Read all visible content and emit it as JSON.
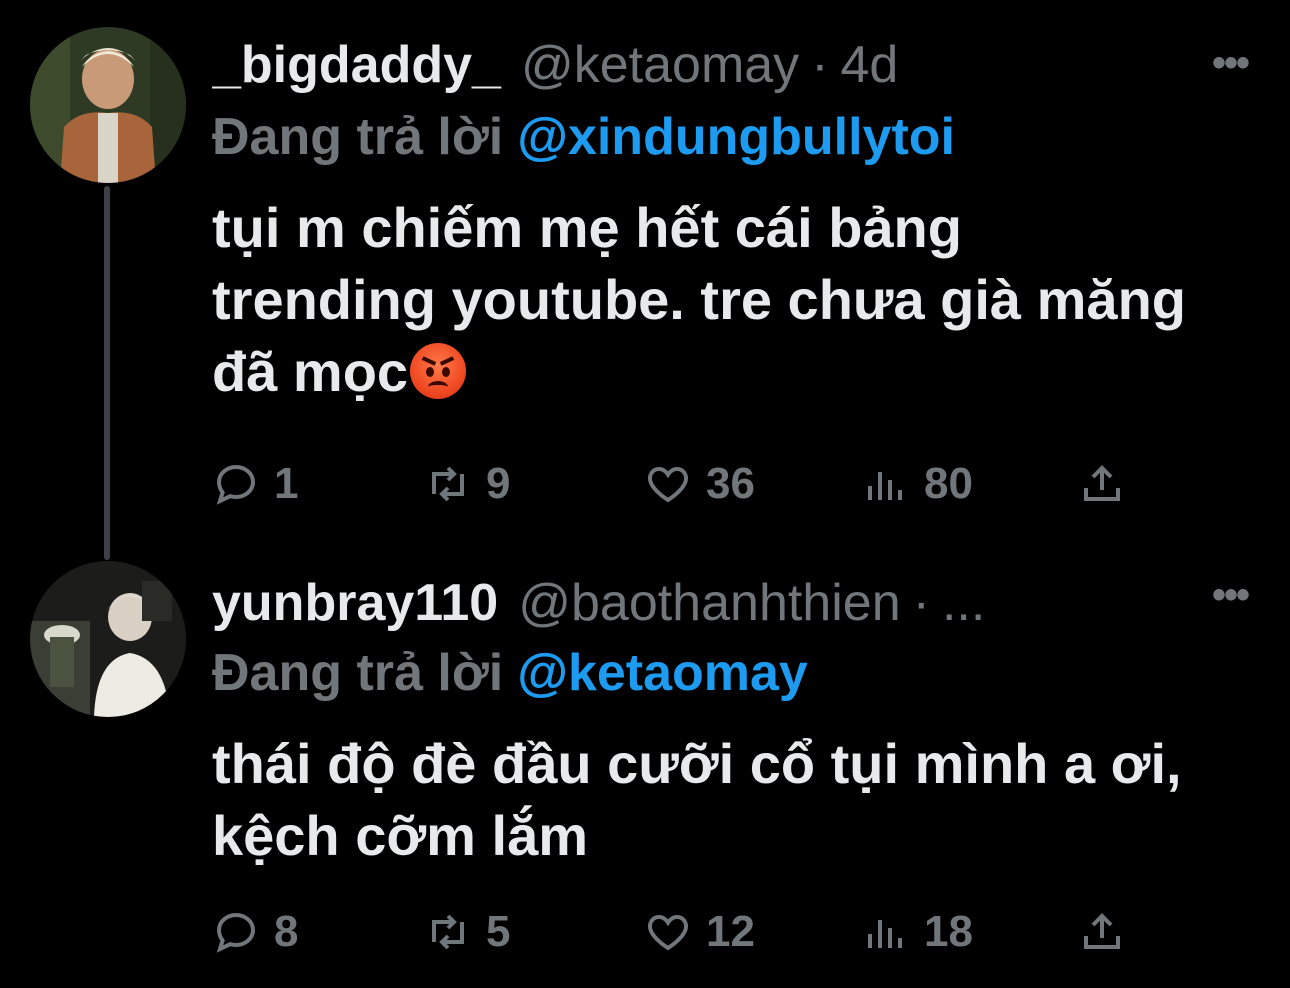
{
  "tweets": [
    {
      "display_name": "_bigdaddy_",
      "handle": "@ketaomay",
      "separator": "·",
      "time": "4d",
      "more": "•••",
      "replying_prefix": "Đang trả lời",
      "replying_to": "@xindungbullytoi",
      "text": "tụi m chiếm mẹ hết cái bảng trending youtube. tre chưa già măng đã mọc",
      "emoji": "angry-face-emoji",
      "stats": {
        "replies": "1",
        "retweets": "9",
        "likes": "36",
        "views": "80"
      }
    },
    {
      "display_name": "yunbray110",
      "handle": "@baothanhthien",
      "separator": "·",
      "time": "...",
      "more": "•••",
      "replying_prefix": "Đang trả lời",
      "replying_to": "@ketaomay",
      "text": "thái độ đè đầu cưỡi cổ tụi mình a ơi, kệch cỡm lắm",
      "stats": {
        "replies": "8",
        "retweets": "5",
        "likes": "12",
        "views": "18"
      }
    }
  ],
  "colors": {
    "background": "#000000",
    "text": "#e7e9ea",
    "muted": "#71767b",
    "accent": "#1d9bf0",
    "thread_line": "#3d4147"
  }
}
